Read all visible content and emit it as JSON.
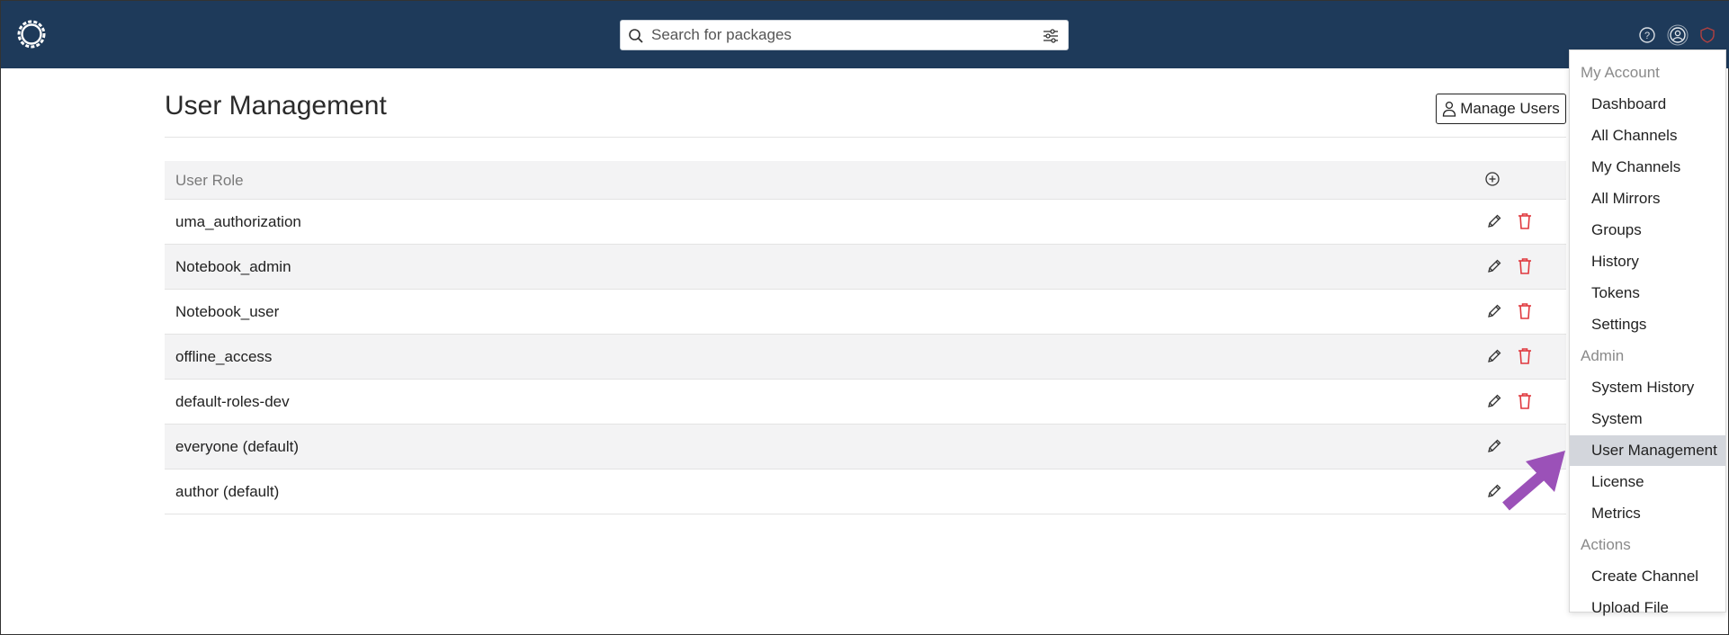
{
  "search": {
    "placeholder": "Search for packages"
  },
  "page": {
    "title": "User Management",
    "manage_users_label": "Manage Users"
  },
  "table": {
    "header": "User Role",
    "rows": [
      {
        "role": "uma_authorization",
        "deletable": true
      },
      {
        "role": "Notebook_admin",
        "deletable": true
      },
      {
        "role": "Notebook_user",
        "deletable": true
      },
      {
        "role": "offline_access",
        "deletable": true
      },
      {
        "role": "default-roles-dev",
        "deletable": true
      },
      {
        "role": "everyone (default)",
        "deletable": false
      },
      {
        "role": "author (default)",
        "deletable": false
      }
    ]
  },
  "menu": {
    "sections": [
      {
        "header": "My Account",
        "items": [
          "Dashboard",
          "All Channels",
          "My Channels",
          "All Mirrors",
          "Groups",
          "History",
          "Tokens",
          "Settings"
        ]
      },
      {
        "header": "Admin",
        "items": [
          "System History",
          "System",
          "User Management",
          "License",
          "Metrics"
        ]
      },
      {
        "header": "Actions",
        "items": [
          "Create Channel",
          "Upload File"
        ]
      }
    ],
    "active_item": "User Management"
  },
  "colors": {
    "topbar": "#1e3a5a",
    "delete": "#e0393e",
    "arrow": "#9b51b8",
    "active_item_bg": "#d3d6dc"
  },
  "icons": [
    "logo-icon",
    "search-icon",
    "filter-icon",
    "help-icon",
    "user-icon",
    "alert-icon",
    "add-icon",
    "edit-icon",
    "trash-icon",
    "user-outline-icon"
  ]
}
